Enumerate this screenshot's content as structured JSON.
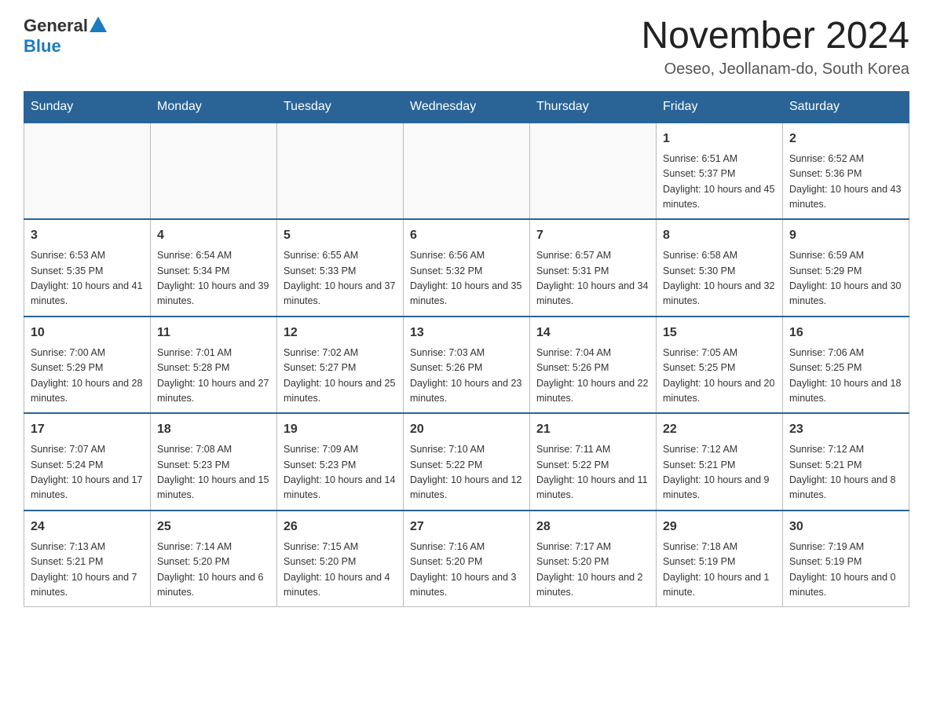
{
  "logo": {
    "general": "General",
    "blue": "Blue"
  },
  "header": {
    "month": "November 2024",
    "location": "Oeseo, Jeollanam-do, South Korea"
  },
  "weekdays": [
    "Sunday",
    "Monday",
    "Tuesday",
    "Wednesday",
    "Thursday",
    "Friday",
    "Saturday"
  ],
  "weeks": [
    [
      {
        "day": "",
        "info": ""
      },
      {
        "day": "",
        "info": ""
      },
      {
        "day": "",
        "info": ""
      },
      {
        "day": "",
        "info": ""
      },
      {
        "day": "",
        "info": ""
      },
      {
        "day": "1",
        "info": "Sunrise: 6:51 AM\nSunset: 5:37 PM\nDaylight: 10 hours and 45 minutes."
      },
      {
        "day": "2",
        "info": "Sunrise: 6:52 AM\nSunset: 5:36 PM\nDaylight: 10 hours and 43 minutes."
      }
    ],
    [
      {
        "day": "3",
        "info": "Sunrise: 6:53 AM\nSunset: 5:35 PM\nDaylight: 10 hours and 41 minutes."
      },
      {
        "day": "4",
        "info": "Sunrise: 6:54 AM\nSunset: 5:34 PM\nDaylight: 10 hours and 39 minutes."
      },
      {
        "day": "5",
        "info": "Sunrise: 6:55 AM\nSunset: 5:33 PM\nDaylight: 10 hours and 37 minutes."
      },
      {
        "day": "6",
        "info": "Sunrise: 6:56 AM\nSunset: 5:32 PM\nDaylight: 10 hours and 35 minutes."
      },
      {
        "day": "7",
        "info": "Sunrise: 6:57 AM\nSunset: 5:31 PM\nDaylight: 10 hours and 34 minutes."
      },
      {
        "day": "8",
        "info": "Sunrise: 6:58 AM\nSunset: 5:30 PM\nDaylight: 10 hours and 32 minutes."
      },
      {
        "day": "9",
        "info": "Sunrise: 6:59 AM\nSunset: 5:29 PM\nDaylight: 10 hours and 30 minutes."
      }
    ],
    [
      {
        "day": "10",
        "info": "Sunrise: 7:00 AM\nSunset: 5:29 PM\nDaylight: 10 hours and 28 minutes."
      },
      {
        "day": "11",
        "info": "Sunrise: 7:01 AM\nSunset: 5:28 PM\nDaylight: 10 hours and 27 minutes."
      },
      {
        "day": "12",
        "info": "Sunrise: 7:02 AM\nSunset: 5:27 PM\nDaylight: 10 hours and 25 minutes."
      },
      {
        "day": "13",
        "info": "Sunrise: 7:03 AM\nSunset: 5:26 PM\nDaylight: 10 hours and 23 minutes."
      },
      {
        "day": "14",
        "info": "Sunrise: 7:04 AM\nSunset: 5:26 PM\nDaylight: 10 hours and 22 minutes."
      },
      {
        "day": "15",
        "info": "Sunrise: 7:05 AM\nSunset: 5:25 PM\nDaylight: 10 hours and 20 minutes."
      },
      {
        "day": "16",
        "info": "Sunrise: 7:06 AM\nSunset: 5:25 PM\nDaylight: 10 hours and 18 minutes."
      }
    ],
    [
      {
        "day": "17",
        "info": "Sunrise: 7:07 AM\nSunset: 5:24 PM\nDaylight: 10 hours and 17 minutes."
      },
      {
        "day": "18",
        "info": "Sunrise: 7:08 AM\nSunset: 5:23 PM\nDaylight: 10 hours and 15 minutes."
      },
      {
        "day": "19",
        "info": "Sunrise: 7:09 AM\nSunset: 5:23 PM\nDaylight: 10 hours and 14 minutes."
      },
      {
        "day": "20",
        "info": "Sunrise: 7:10 AM\nSunset: 5:22 PM\nDaylight: 10 hours and 12 minutes."
      },
      {
        "day": "21",
        "info": "Sunrise: 7:11 AM\nSunset: 5:22 PM\nDaylight: 10 hours and 11 minutes."
      },
      {
        "day": "22",
        "info": "Sunrise: 7:12 AM\nSunset: 5:21 PM\nDaylight: 10 hours and 9 minutes."
      },
      {
        "day": "23",
        "info": "Sunrise: 7:12 AM\nSunset: 5:21 PM\nDaylight: 10 hours and 8 minutes."
      }
    ],
    [
      {
        "day": "24",
        "info": "Sunrise: 7:13 AM\nSunset: 5:21 PM\nDaylight: 10 hours and 7 minutes."
      },
      {
        "day": "25",
        "info": "Sunrise: 7:14 AM\nSunset: 5:20 PM\nDaylight: 10 hours and 6 minutes."
      },
      {
        "day": "26",
        "info": "Sunrise: 7:15 AM\nSunset: 5:20 PM\nDaylight: 10 hours and 4 minutes."
      },
      {
        "day": "27",
        "info": "Sunrise: 7:16 AM\nSunset: 5:20 PM\nDaylight: 10 hours and 3 minutes."
      },
      {
        "day": "28",
        "info": "Sunrise: 7:17 AM\nSunset: 5:20 PM\nDaylight: 10 hours and 2 minutes."
      },
      {
        "day": "29",
        "info": "Sunrise: 7:18 AM\nSunset: 5:19 PM\nDaylight: 10 hours and 1 minute."
      },
      {
        "day": "30",
        "info": "Sunrise: 7:19 AM\nSunset: 5:19 PM\nDaylight: 10 hours and 0 minutes."
      }
    ]
  ]
}
